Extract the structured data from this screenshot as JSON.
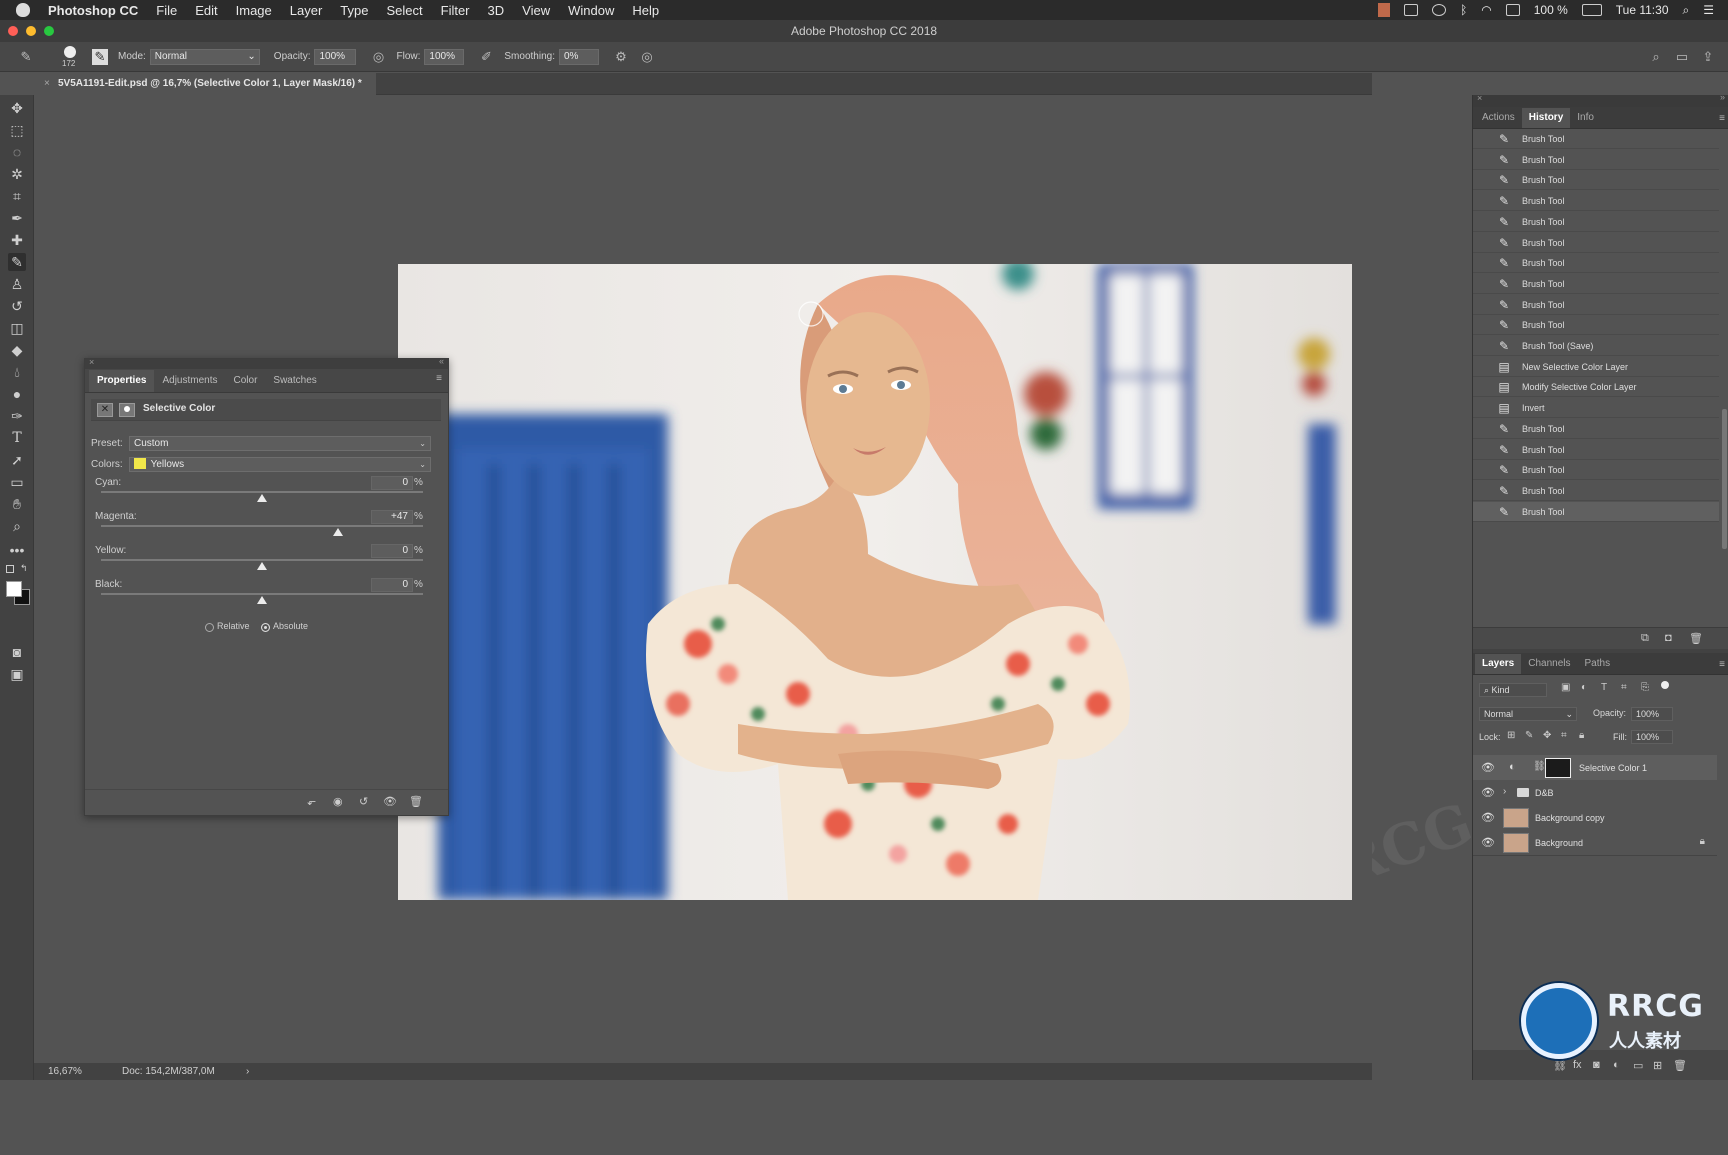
{
  "menubar": {
    "app_name": "Photoshop CC",
    "items": [
      "File",
      "Edit",
      "Image",
      "Layer",
      "Type",
      "Select",
      "Filter",
      "3D",
      "View",
      "Window",
      "Help"
    ],
    "battery": "100 %",
    "clock": "Tue 11:30"
  },
  "window": {
    "title": "Adobe Photoshop CC 2018"
  },
  "options": {
    "brush_size": "172",
    "mode_label": "Mode:",
    "mode_value": "Normal",
    "opacity_label": "Opacity:",
    "opacity_value": "100%",
    "flow_label": "Flow:",
    "flow_value": "100%",
    "smoothing_label": "Smoothing:",
    "smoothing_value": "0%"
  },
  "document": {
    "tab_title": "5V5A1191-Edit.psd @ 16,7% (Selective Color 1, Layer Mask/16) *",
    "tab_close": "×"
  },
  "status": {
    "zoom": "16,67%",
    "doc_info": "Doc: 154,2M/387,0M",
    "arrow": "›"
  },
  "properties": {
    "tabs": [
      "Properties",
      "Adjustments",
      "Color",
      "Swatches"
    ],
    "title": "Selective Color",
    "preset_label": "Preset:",
    "preset_value": "Custom",
    "colors_label": "Colors:",
    "colors_value": "Yellows",
    "colors_swatch": "#f2e84a",
    "sliders": [
      {
        "label": "Cyan:",
        "value": "0",
        "unit": "%",
        "position": 0.5
      },
      {
        "label": "Magenta:",
        "value": "+47",
        "unit": "%",
        "position": 0.735
      },
      {
        "label": "Yellow:",
        "value": "0",
        "unit": "%",
        "position": 0.5
      },
      {
        "label": "Black:",
        "value": "0",
        "unit": "%",
        "position": 0.5
      }
    ],
    "relative_label": "Relative",
    "absolute_label": "Absolute"
  },
  "history_panel": {
    "tabs": [
      "Actions",
      "History",
      "Info"
    ],
    "items": [
      {
        "label": "Brush Tool",
        "icon": "brush-icon"
      },
      {
        "label": "Brush Tool",
        "icon": "brush-icon"
      },
      {
        "label": "Brush Tool",
        "icon": "brush-icon"
      },
      {
        "label": "Brush Tool",
        "icon": "brush-icon"
      },
      {
        "label": "Brush Tool",
        "icon": "brush-icon"
      },
      {
        "label": "Brush Tool",
        "icon": "brush-icon"
      },
      {
        "label": "Brush Tool",
        "icon": "brush-icon"
      },
      {
        "label": "Brush Tool",
        "icon": "brush-icon"
      },
      {
        "label": "Brush Tool",
        "icon": "brush-icon"
      },
      {
        "label": "Brush Tool",
        "icon": "brush-icon"
      },
      {
        "label": "Brush Tool (Save)",
        "icon": "brush-icon"
      },
      {
        "label": "New Selective Color Layer",
        "icon": "document-icon"
      },
      {
        "label": "Modify Selective Color Layer",
        "icon": "document-icon"
      },
      {
        "label": "Invert",
        "icon": "document-icon"
      },
      {
        "label": "Brush Tool",
        "icon": "brush-icon"
      },
      {
        "label": "Brush Tool",
        "icon": "brush-icon"
      },
      {
        "label": "Brush Tool",
        "icon": "brush-icon"
      },
      {
        "label": "Brush Tool",
        "icon": "brush-icon"
      },
      {
        "label": "Brush Tool",
        "icon": "brush-icon"
      }
    ]
  },
  "layers_panel": {
    "tabs": [
      "Layers",
      "Channels",
      "Paths"
    ],
    "kind_label": "Kind",
    "blend_mode": "Normal",
    "opacity_label": "Opacity:",
    "opacity_value": "100%",
    "lock_label": "Lock:",
    "fill_label": "Fill:",
    "fill_value": "100%",
    "layers": [
      {
        "name": "Selective Color 1"
      },
      {
        "name": "D&B"
      },
      {
        "name": "Background copy"
      },
      {
        "name": "Background"
      }
    ]
  },
  "watermark": {
    "text": "RRCG",
    "cn_text": "人人素材"
  },
  "colors": {
    "accent_blue": "#2f5fa8",
    "panel_bg": "#535353",
    "dock_bg": "#424242"
  }
}
